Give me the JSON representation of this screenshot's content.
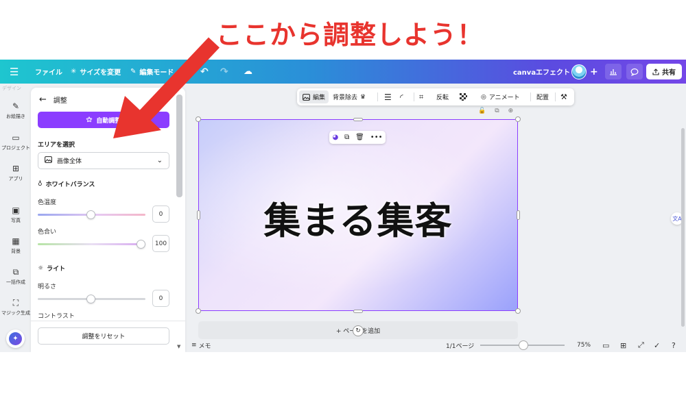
{
  "annotation": {
    "headline": "ここから調整しよう！"
  },
  "topbar": {
    "menu_icon": "☰",
    "file": "ファイル",
    "resize": "サイズを変更",
    "edit_mode": "編集モード",
    "doc_name": "canvaエフェクト",
    "share": "共有"
  },
  "rail": {
    "faded_label": "デザイン",
    "items": [
      {
        "label": "お絵描き",
        "icon": "pen-icon"
      },
      {
        "label": "プロジェクト",
        "icon": "folder-icon"
      },
      {
        "label": "アプリ",
        "icon": "apps-icon"
      },
      {
        "label": "写真",
        "icon": "photo-icon"
      },
      {
        "label": "背景",
        "icon": "background-icon"
      },
      {
        "label": "一括作成",
        "icon": "bulk-create-icon"
      },
      {
        "label": "マジック生成",
        "icon": "magic-media-icon"
      }
    ]
  },
  "panel": {
    "title": "調整",
    "auto_adjust": "自動調整",
    "area_section": "エリアを選択",
    "area_value": "画像全体",
    "white_balance": "ホワイトバランス",
    "temperature_label": "色温度",
    "temperature_value": "0",
    "tint_label": "色合い",
    "tint_value": "100",
    "light": "ライト",
    "brightness_label": "明るさ",
    "brightness_value": "0",
    "contrast_label": "コントラスト",
    "reset": "調整をリセット"
  },
  "image_toolbar": {
    "edit": "編集",
    "bg_remove": "背景除去",
    "flip": "反転",
    "animate": "アニメート",
    "position": "配置"
  },
  "canvas": {
    "text": "集まる集客",
    "add_page": "+ ページを追加",
    "gradient_colors": [
      "#c6cdfa",
      "#ede3fb",
      "#9aa1fb"
    ],
    "selection_color": "#8b3dff"
  },
  "bottombar": {
    "notes": "メモ",
    "page": "1/1ページ",
    "zoom": "75%",
    "zoom_level": 0.45
  },
  "colors": {
    "accent": "#8b3dff",
    "annotation_red": "#e8342e"
  }
}
